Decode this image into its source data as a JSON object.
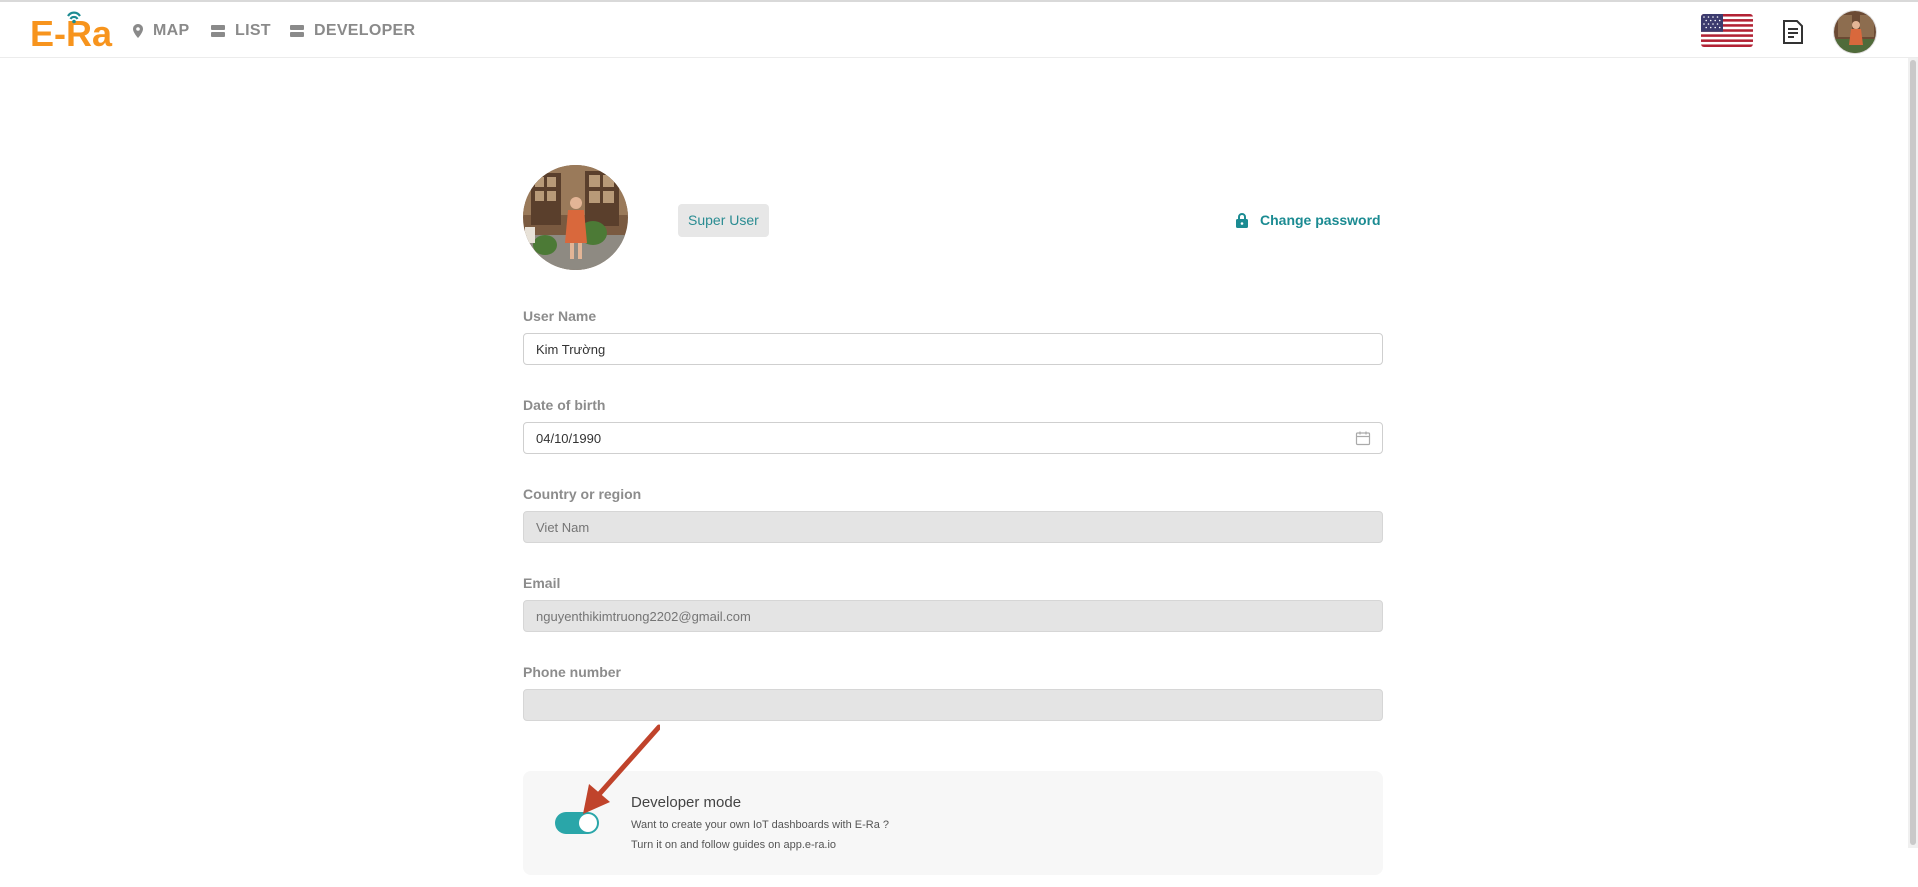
{
  "header": {
    "logo_text": "E-Ra",
    "nav": [
      {
        "label": "MAP",
        "icon": "map-pin-icon"
      },
      {
        "label": "LIST",
        "icon": "list-icon"
      },
      {
        "label": "DEVELOPER",
        "icon": "developer-icon"
      }
    ],
    "language_flag": "us-flag-icon",
    "docs_icon": "document-icon",
    "avatar": "user-avatar"
  },
  "profile": {
    "role_badge": "Super User",
    "change_password_label": "Change password",
    "fields": {
      "username": {
        "label": "User Name",
        "value": "Kim Trường"
      },
      "dob": {
        "label": "Date of birth",
        "value": "04/10/1990"
      },
      "country": {
        "label": "Country or region",
        "placeholder": "Viet Nam"
      },
      "email": {
        "label": "Email",
        "placeholder": "nguyenthikimtruong2202@gmail.com"
      },
      "phone": {
        "label": "Phone number",
        "value": ""
      }
    },
    "developer_mode": {
      "title": "Developer mode",
      "line1": "Want to create your own IoT dashboards with E-Ra ?",
      "line2": "Turn it on and follow guides on app.e-ra.io",
      "enabled": true
    }
  },
  "colors": {
    "brand_orange": "#f7941d",
    "accent_teal": "#1b8b92",
    "toggle_on": "#2aa6a9",
    "annotation_arrow": "#c0432b"
  }
}
